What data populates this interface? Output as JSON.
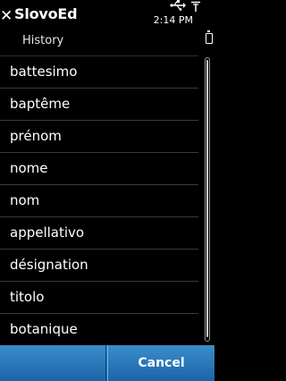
{
  "header": {
    "app_title": "SlovoEd",
    "subtitle": "History"
  },
  "status": {
    "time": "2:14 PM"
  },
  "history": {
    "items": [
      "battesimo",
      "baptême",
      "prénom",
      "nome",
      "nom",
      "appellativo",
      "désignation",
      "titolo",
      "botanique"
    ]
  },
  "softkeys": {
    "left_label": "",
    "right_label": "Cancel"
  },
  "colors": {
    "background": "#000000",
    "softkey_bar": "#2a7bbd",
    "divider": "#3a3a3a"
  },
  "icons": {
    "close": "close-icon",
    "usb": "usb-icon",
    "signal": "signal-icon",
    "battery": "battery-icon"
  }
}
